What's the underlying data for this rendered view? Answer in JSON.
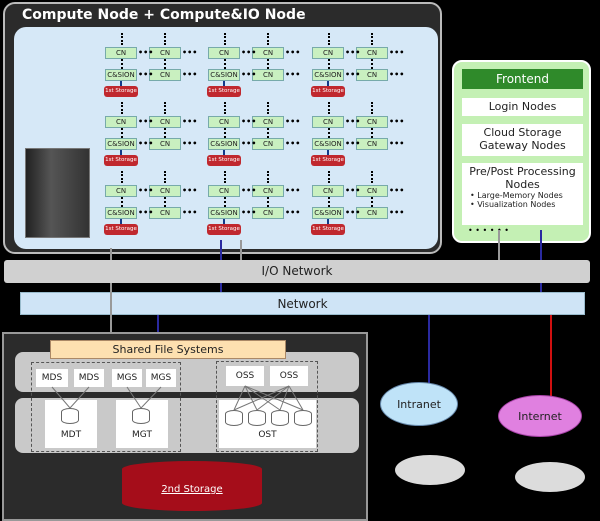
{
  "compute": {
    "title": "Compute Node + Compute&IO Node",
    "cn": "CN",
    "csion": "C&SION",
    "storage1": "1st Storage"
  },
  "frontend": {
    "title": "Frontend",
    "login": "Login Nodes",
    "cloud": "Cloud Storage Gateway Nodes",
    "prepost": "Pre/Post Processing Nodes",
    "items": [
      "• Large-Memory Nodes",
      "• Visualization Nodes"
    ],
    "dots": "•  •  •       •  •  •"
  },
  "io_network": "I/O Network",
  "network": "Network",
  "fs": {
    "title": "Shared File Systems",
    "mds": "MDS",
    "mgs": "MGS",
    "oss": "OSS",
    "mdt": "MDT",
    "mgt": "MGT",
    "ost": "OST",
    "storage2": "2nd Storage"
  },
  "clouds": {
    "intranet": "Intranet",
    "internet": "Internet"
  },
  "colors": {
    "storage": "#c0282e",
    "frontend_accent": "#2f8a2a",
    "internet": "#e080e0",
    "intranet": "#bfe3f8"
  }
}
